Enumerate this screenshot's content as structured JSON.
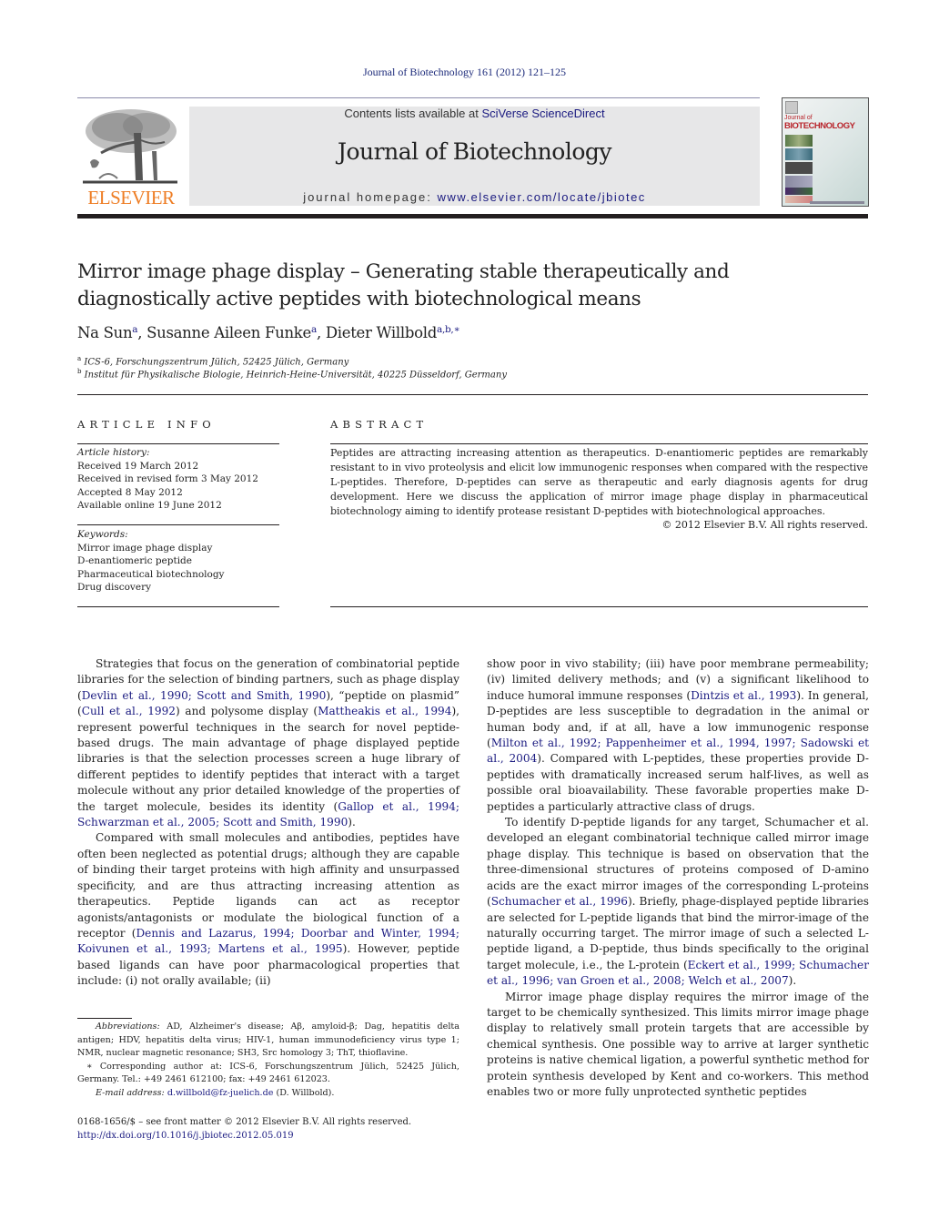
{
  "header": {
    "citation": "Journal of Biotechnology 161 (2012) 121–125",
    "contents_prefix": "Contents lists available at ",
    "contents_link": "SciVerse ScienceDirect",
    "journal_name": "Journal of Biotechnology",
    "homepage_prefix": "journal homepage: ",
    "homepage_link": "www.elsevier.com/locate/jbiotec",
    "publisher_logo_text": "ELSEVIER",
    "cover": {
      "small": "Journal of",
      "title": "BIOTECHNOLOGY"
    },
    "colors": {
      "publisher_orange": "#ee7d24",
      "link_blue": "#1a1a80",
      "masthead_gray": "#e7e7e8",
      "cover_red": "#b8232a"
    }
  },
  "article": {
    "title_line1": "Mirror image phage display – Generating stable therapeutically and",
    "title_line2": "diagnostically active peptides with biotechnological means",
    "authors": [
      {
        "name": "Na Sun",
        "sup": "a"
      },
      {
        "name": "Susanne Aileen Funke",
        "sup": "a"
      },
      {
        "name": "Dieter Willbold",
        "sup": "a,b,∗"
      }
    ],
    "affiliations": [
      {
        "mark": "a",
        "text": "ICS-6, Forschungszentrum Jülich, 52425 Jülich, Germany"
      },
      {
        "mark": "b",
        "text": "Institut für Physikalische Biologie, Heinrich-Heine-Universität, 40225 Düsseldorf, Germany"
      }
    ]
  },
  "article_info": {
    "heading": "ARTICLE INFO",
    "history_label": "Article history:",
    "history": [
      "Received 19 March 2012",
      "Received in revised form 3 May 2012",
      "Accepted 8 May 2012",
      "Available online 19 June 2012"
    ],
    "keywords_label": "Keywords:",
    "keywords": [
      "Mirror image phage display",
      "D-enantiomeric peptide",
      "Pharmaceutical biotechnology",
      "Drug discovery"
    ]
  },
  "abstract": {
    "heading": "ABSTRACT",
    "text": "Peptides are attracting increasing attention as therapeutics. D-enantiomeric peptides are remarkably resistant to in vivo proteolysis and elicit low immunogenic responses when compared with the respective L-peptides. Therefore, D-peptides can serve as therapeutic and early diagnosis agents for drug development. Here we discuss the application of mirror image phage display in pharmaceutical biotechnology aiming to identify protease resistant D-peptides with biotechnological approaches.",
    "copyright": "© 2012 Elsevier B.V. All rights reserved."
  },
  "body": {
    "left_column": [
      [
        {
          "t": "Strategies that focus on the generation of combinatorial peptide libraries for the selection of binding partners, such as phage display ("
        },
        {
          "l": "Devlin et al., 1990; Scott and Smith, 1990"
        },
        {
          "t": "), “peptide on plasmid” ("
        },
        {
          "l": "Cull et al., 1992"
        },
        {
          "t": ") and polysome display ("
        },
        {
          "l": "Mattheakis et al., 1994"
        },
        {
          "t": "), represent powerful techniques in the search for novel peptide-based drugs. The main advantage of phage displayed peptide libraries is that the selection processes screen a huge library of different peptides to identify peptides that interact with a target molecule without any prior detailed knowledge of the properties of the target molecule, besides its identity ("
        },
        {
          "l": "Gallop et al., 1994; Schwarzman et al., 2005; Scott and Smith, 1990"
        },
        {
          "t": ")."
        }
      ],
      [
        {
          "t": "Compared with small molecules and antibodies, peptides have often been neglected as potential drugs; although they are capable of binding their target proteins with high affinity and unsurpassed specificity, and are thus attracting increasing attention as therapeutics. Peptide ligands can act as receptor agonists/antagonists or modulate the biological function of a receptor ("
        },
        {
          "l": "Dennis and Lazarus, 1994; Doorbar and Winter, 1994; Koivunen et al., 1993; Martens et al., 1995"
        },
        {
          "t": "). However, peptide based ligands can have poor pharmacological properties that include: (i) not orally available; (ii)"
        }
      ]
    ],
    "right_column": [
      [
        {
          "t": "show poor in vivo stability; (iii) have poor membrane permeability; (iv) limited delivery methods; and (v) a significant likelihood to induce humoral immune responses ("
        },
        {
          "l": "Dintzis et al., 1993"
        },
        {
          "t": "). In general, D-peptides are less susceptible to degradation in the animal or human body and, if at all, have a low immunogenic response ("
        },
        {
          "l": "Milton et al., 1992; Pappenheimer et al., 1994, 1997; Sadowski et al., 2004"
        },
        {
          "t": "). Compared with L-peptides, these properties provide D-peptides with dramatically increased serum half-lives, as well as possible oral bioavailability. These favorable properties make D-peptides a particularly attractive class of drugs."
        }
      ],
      [
        {
          "t": "To identify D-peptide ligands for any target, Schumacher et al. developed an elegant combinatorial technique called mirror image phage display. This technique is based on observation that the three-dimensional structures of proteins composed of D-amino acids are the exact mirror images of the corresponding L-proteins ("
        },
        {
          "l": "Schumacher et al., 1996"
        },
        {
          "t": "). Briefly, phage-displayed peptide libraries are selected for L-peptide ligands that bind the mirror-image of the naturally occurring target. The mirror image of such a selected L-peptide ligand, a D-peptide, thus binds specifically to the original target molecule, i.e., the L-protein ("
        },
        {
          "l": "Eckert et al., 1999; Schumacher et al., 1996; van Groen et al., 2008; Welch et al., 2007"
        },
        {
          "t": ")."
        }
      ],
      [
        {
          "t": "Mirror image phage display requires the mirror image of the target to be chemically synthesized. This limits mirror image phage display to relatively small protein targets that are accessible by chemical synthesis. One possible way to arrive at larger synthetic proteins is native chemical ligation, a powerful synthetic method for protein synthesis developed by Kent and co-workers. This method enables two or more fully unprotected synthetic peptides"
        }
      ]
    ]
  },
  "footnotes": {
    "abbrev_label": "Abbreviations:",
    "abbrev_text": "AD, Alzheimer's disease; Aβ, amyloid-β; Dag, hepatitis delta antigen; HDV, hepatitis delta virus; HIV-1, human immunodeficiency virus type 1; NMR, nuclear magnetic resonance; SH3, Src homology 3; ThT, thioflavine.",
    "corresponding": "∗ Corresponding author at: ICS-6, Forschungszentrum Jülich, 52425 Jülich, Germany. Tel.: +49 2461 612100; fax: +49 2461 612023.",
    "email_label": "E-mail address:",
    "email": "d.willbold@fz-juelich.de",
    "email_suffix": " (D. Willbold).",
    "front_matter": "0168-1656/$ – see front matter © 2012 Elsevier B.V. All rights reserved.",
    "doi": "http://dx.doi.org/10.1016/j.jbiotec.2012.05.019"
  }
}
